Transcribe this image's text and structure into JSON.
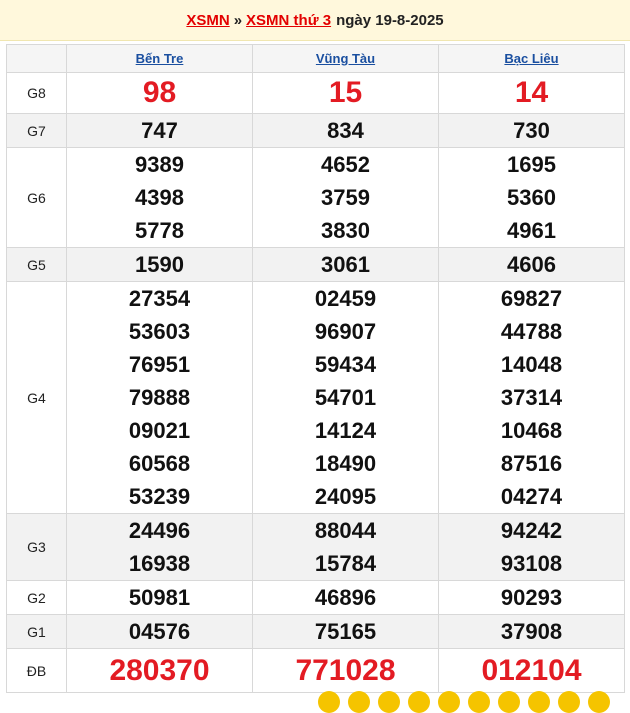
{
  "header": {
    "link_main": "XSMN",
    "separator": "»",
    "link_day": "XSMN thứ 3",
    "date_text": "ngày 19-8-2025"
  },
  "provinces": [
    "Bến Tre",
    "Vũng Tàu",
    "Bạc Liêu"
  ],
  "prizes": {
    "G8": {
      "label": "G8",
      "values": [
        [
          "98"
        ],
        [
          "15"
        ],
        [
          "14"
        ]
      ]
    },
    "G7": {
      "label": "G7",
      "values": [
        [
          "747"
        ],
        [
          "834"
        ],
        [
          "730"
        ]
      ]
    },
    "G6": {
      "label": "G6",
      "values": [
        [
          "9389",
          "4398",
          "5778"
        ],
        [
          "4652",
          "3759",
          "3830"
        ],
        [
          "1695",
          "5360",
          "4961"
        ]
      ]
    },
    "G5": {
      "label": "G5",
      "values": [
        [
          "1590"
        ],
        [
          "3061"
        ],
        [
          "4606"
        ]
      ]
    },
    "G4": {
      "label": "G4",
      "values": [
        [
          "27354",
          "53603",
          "76951",
          "79888",
          "09021",
          "60568",
          "53239"
        ],
        [
          "02459",
          "96907",
          "59434",
          "54701",
          "14124",
          "18490",
          "24095"
        ],
        [
          "69827",
          "44788",
          "14048",
          "37314",
          "10468",
          "87516",
          "04274"
        ]
      ]
    },
    "G3": {
      "label": "G3",
      "values": [
        [
          "24496",
          "16938"
        ],
        [
          "88044",
          "15784"
        ],
        [
          "94242",
          "93108"
        ]
      ]
    },
    "G2": {
      "label": "G2",
      "values": [
        [
          "50981"
        ],
        [
          "46896"
        ],
        [
          "90293"
        ]
      ]
    },
    "G1": {
      "label": "G1",
      "values": [
        [
          "04576"
        ],
        [
          "75165"
        ],
        [
          "37908"
        ]
      ]
    },
    "DB": {
      "label": "ĐB",
      "values": [
        [
          "280370"
        ],
        [
          "771028"
        ],
        [
          "012104"
        ]
      ]
    }
  },
  "colors": {
    "accent_red": "#e31b23",
    "link_blue": "#1a4fa0",
    "header_bg": "#fff8dc"
  }
}
